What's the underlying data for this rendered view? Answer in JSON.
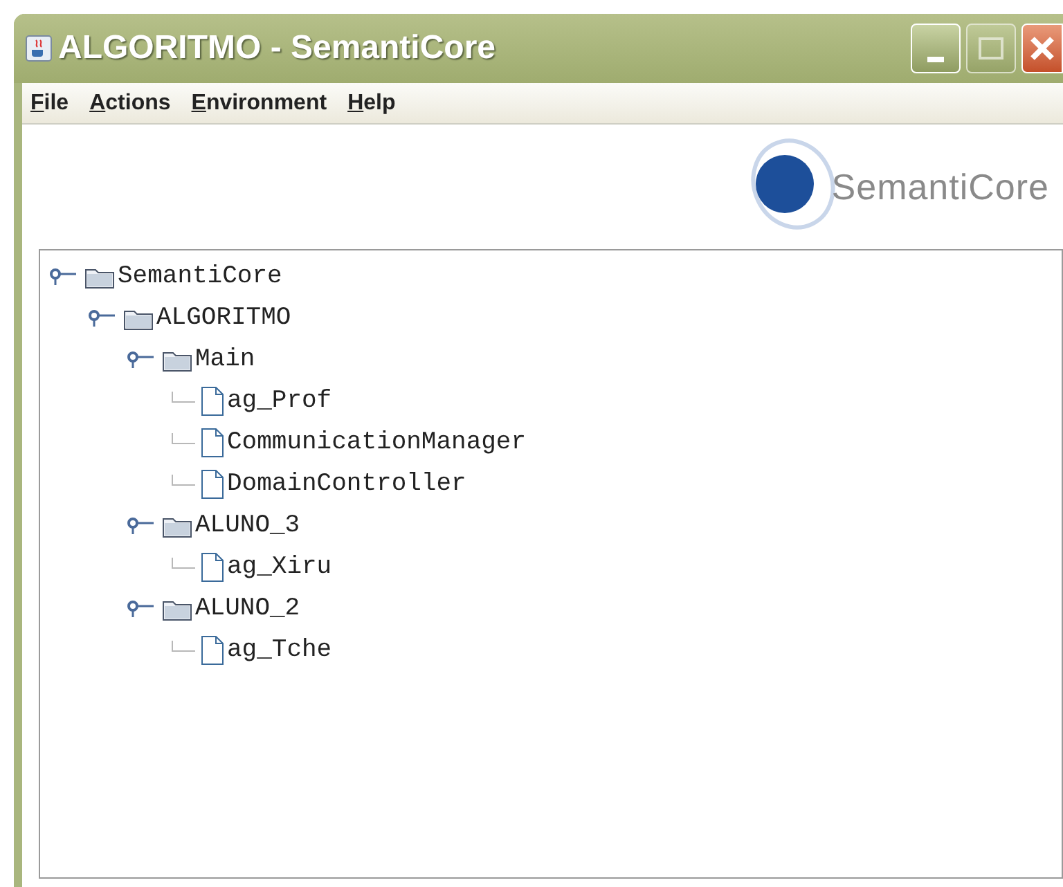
{
  "window": {
    "title": "ALGORITMO - SemantiCore"
  },
  "menu": [
    {
      "label": "File"
    },
    {
      "label": "Actions"
    },
    {
      "label": "Environment"
    },
    {
      "label": "Help"
    }
  ],
  "logo": {
    "text": "SemantiCore"
  },
  "tree": [
    {
      "label": "SemantiCore",
      "kind": "folder",
      "expanded": true,
      "children": [
        {
          "label": "ALGORITMO",
          "kind": "folder",
          "expanded": true,
          "children": [
            {
              "label": "Main",
              "kind": "folder",
              "expanded": true,
              "children": [
                {
                  "label": "ag_Prof",
                  "kind": "file"
                },
                {
                  "label": "CommunicationManager",
                  "kind": "file"
                },
                {
                  "label": "DomainController",
                  "kind": "file"
                }
              ]
            },
            {
              "label": "ALUNO_3",
              "kind": "folder",
              "expanded": true,
              "children": [
                {
                  "label": "ag_Xiru",
                  "kind": "file"
                }
              ]
            },
            {
              "label": "ALUNO_2",
              "kind": "folder",
              "expanded": true,
              "children": [
                {
                  "label": "ag_Tche",
                  "kind": "file"
                }
              ]
            }
          ]
        }
      ]
    }
  ]
}
